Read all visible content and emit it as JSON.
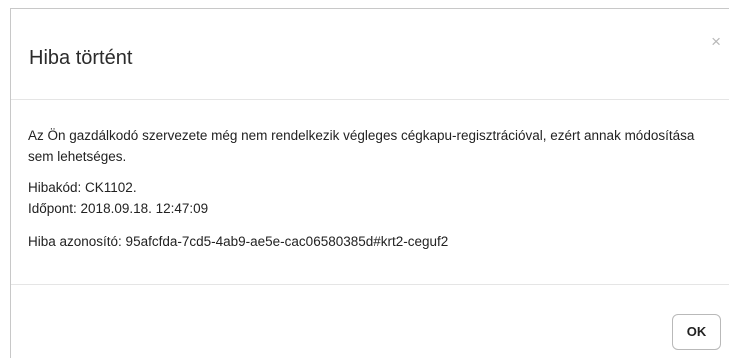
{
  "dialog": {
    "title": "Hiba történt",
    "close_icon": "close-icon",
    "close_symbol": "×",
    "message": "Az Ön gazdálkodó szervezete még nem rendelkezik végleges cégkapu-regisztrációval, ezért annak módosítása sem lehetséges.",
    "error_code": "Hibakód: CK1102.",
    "timestamp": "Időpont: 2018.09.18. 12:47:09",
    "error_id": "Hiba azonosító: 95afcfda-7cd5-4ab9-ae5e-cac06580385d#krt2-ceguf2",
    "ok_label": "OK"
  }
}
